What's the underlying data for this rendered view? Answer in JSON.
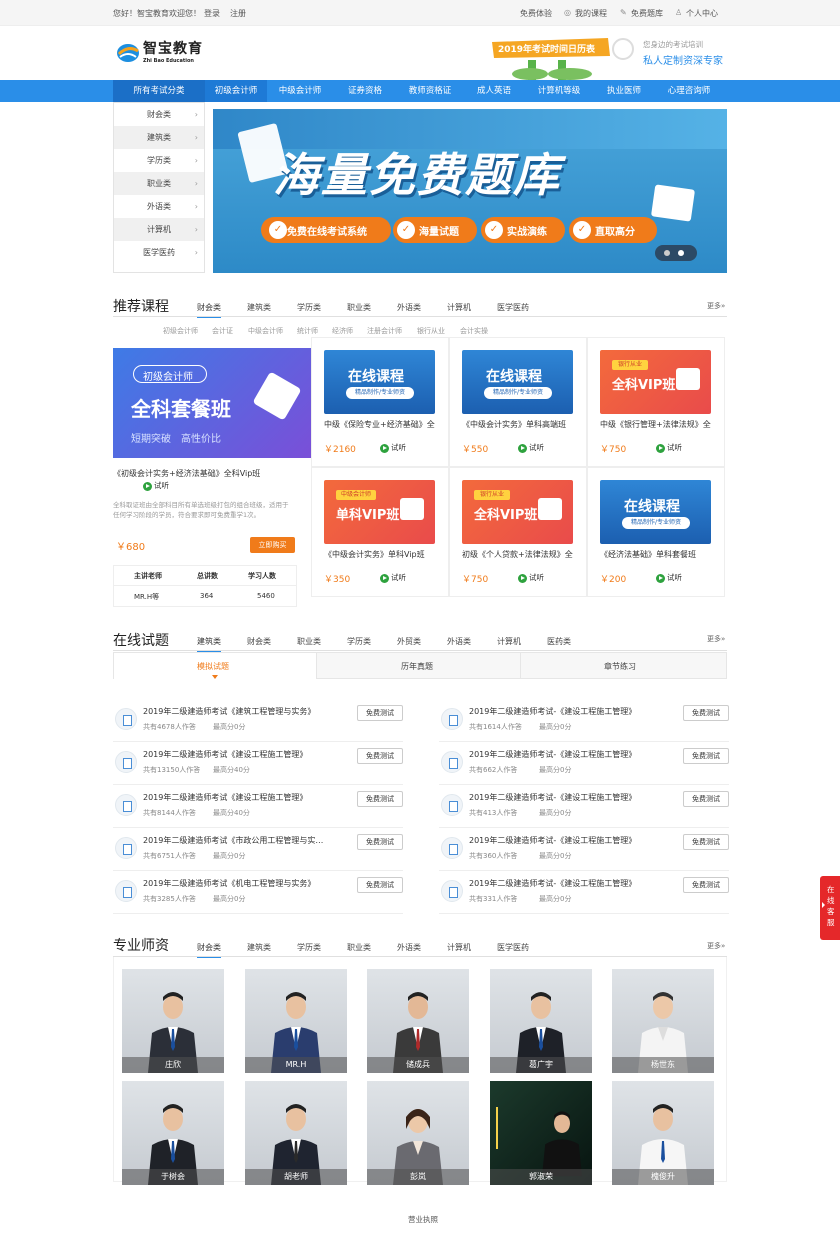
{
  "topbar": {
    "welcome": "您好！智宝教育欢迎您！",
    "login": "登录",
    "register": "注册",
    "free_trial": "免费体验",
    "my_course": "我的课程",
    "free_bank": "免费题库",
    "personal": "个人中心"
  },
  "logo": {
    "name": "智宝教育",
    "sub": "Zhi Bao Education"
  },
  "header": {
    "calendar": "2019年考试时间日历表",
    "slogan1": "您身边的考试培训",
    "slogan2": "私人定制资深专家"
  },
  "nav": [
    "所有考试分类",
    "初级会计师",
    "中级会计师",
    "证券资格",
    "教师资格证",
    "成人英语",
    "计算机等级",
    "执业医师",
    "心理咨询师"
  ],
  "side": [
    "财会类",
    "建筑类",
    "学历类",
    "职业类",
    "外语类",
    "计算机",
    "医学医药"
  ],
  "banner": {
    "title": "海量免费题库",
    "tags": [
      "免费在线考试系统",
      "海量试题",
      "实战演练",
      "直取高分"
    ]
  },
  "recommend": {
    "title": "推荐课程",
    "tabs": [
      "财会类",
      "建筑类",
      "学历类",
      "职业类",
      "外语类",
      "计算机",
      "医学医药"
    ],
    "more": "更多»",
    "subtabs": [
      "初级会计师",
      "会计证",
      "中级会计师",
      "统计师",
      "经济师",
      "注册会计师",
      "银行从业",
      "会计实操"
    ],
    "feature": {
      "badge": "初级会计师",
      "title": "全科套餐班",
      "tagline": "短期突破　高性价比",
      "name": "《初级会计实务+经济法基础》全科Vip班",
      "try": "试听",
      "desc": "全科取证班由全部科目所有单选班级打包的组合班级，适用于任何学习阶段的学员，符合要求即可免费重学1次。",
      "price": "￥680",
      "buy": "立即购买",
      "th": [
        "主讲老师",
        "总讲数",
        "学习人数"
      ],
      "td": [
        "MR.H等",
        "364",
        "5460"
      ]
    },
    "cards": [
      {
        "img": "在线课程",
        "tag": "精品制作/专业师资",
        "name": "中级《保险专业+经济基础》全",
        "price": "￥2160",
        "try": "试听"
      },
      {
        "img": "在线课程",
        "tag": "精品制作/专业师资",
        "name": "《中级会计实务》单科高端班",
        "price": "￥550",
        "try": "试听"
      },
      {
        "img": "全科VIP班",
        "tag": "银行从业",
        "name": "中级《银行管理+法律法规》全",
        "price": "￥750",
        "try": "试听"
      },
      {
        "img": "单科VIP班",
        "tag": "中级会计师",
        "name": "《中级会计实务》单科Vip班",
        "price": "￥350",
        "try": "试听"
      },
      {
        "img": "全科VIP班",
        "tag": "银行从业",
        "name": "初级《个人贷款+法律法规》全",
        "price": "￥750",
        "try": "试听"
      },
      {
        "img": "在线课程",
        "tag": "精品制作/专业师资",
        "name": "《经济法基础》单科套餐班",
        "price": "￥200",
        "try": "试听"
      }
    ]
  },
  "exam": {
    "title": "在线试题",
    "tabs": [
      "建筑类",
      "财会类",
      "职业类",
      "学历类",
      "外贸类",
      "外语类",
      "计算机",
      "医药类"
    ],
    "more": "更多»",
    "subtabs": [
      "模拟试题",
      "历年真题",
      "章节练习"
    ],
    "left": [
      {
        "t": "2019年二级建造师考试《建筑工程管理与实务》",
        "c1": "共有4678人作答",
        "c2": "最高分0分",
        "btn": "免费测试"
      },
      {
        "t": "2019年二级建造师考试《建设工程施工管理》",
        "c1": "共有13150人作答",
        "c2": "最高分40分",
        "btn": "免费测试"
      },
      {
        "t": "2019年二级建造师考试《建设工程施工管理》",
        "c1": "共有8144人作答",
        "c2": "最高分40分",
        "btn": "免费测试"
      },
      {
        "t": "2019年二级建造师考试《市政公用工程管理与实务》",
        "c1": "共有6751人作答",
        "c2": "最高分0分",
        "btn": "免费测试"
      },
      {
        "t": "2019年二级建造师考试《机电工程管理与实务》",
        "c1": "共有3285人作答",
        "c2": "最高分0分",
        "btn": "免费测试"
      }
    ],
    "right": [
      {
        "t": "2019年二级建造师考试-《建设工程施工管理》",
        "c1": "共有1614人作答",
        "c2": "最高分0分",
        "btn": "免费测试"
      },
      {
        "t": "2019年二级建造师考试-《建设工程施工管理》",
        "c1": "共有662人作答",
        "c2": "最高分0分",
        "btn": "免费测试"
      },
      {
        "t": "2019年二级建造师考试-《建设工程施工管理》",
        "c1": "共有413人作答",
        "c2": "最高分0分",
        "btn": "免费测试"
      },
      {
        "t": "2019年二级建造师考试-《建设工程施工管理》",
        "c1": "共有360人作答",
        "c2": "最高分0分",
        "btn": "免费测试"
      },
      {
        "t": "2019年二级建造师考试-《建设工程施工管理》",
        "c1": "共有331人作答",
        "c2": "最高分0分",
        "btn": "免费测试"
      }
    ]
  },
  "teachers": {
    "title": "专业师资",
    "tabs": [
      "财会类",
      "建筑类",
      "学历类",
      "职业类",
      "外语类",
      "计算机",
      "医学医药"
    ],
    "more": "更多»",
    "names": [
      "庄欣",
      "MR.H",
      "储成兵",
      "葛广宇",
      "杨世东",
      "于树会",
      "胡老师",
      "彭岚",
      "郭淑荣",
      "槐俊升"
    ]
  },
  "footer": {
    "license": "营业执照"
  },
  "service": "在线客服",
  "colors": {
    "nav": "#2a8ee8",
    "price": "#f07b1a",
    "buy": "#f07b1a"
  }
}
